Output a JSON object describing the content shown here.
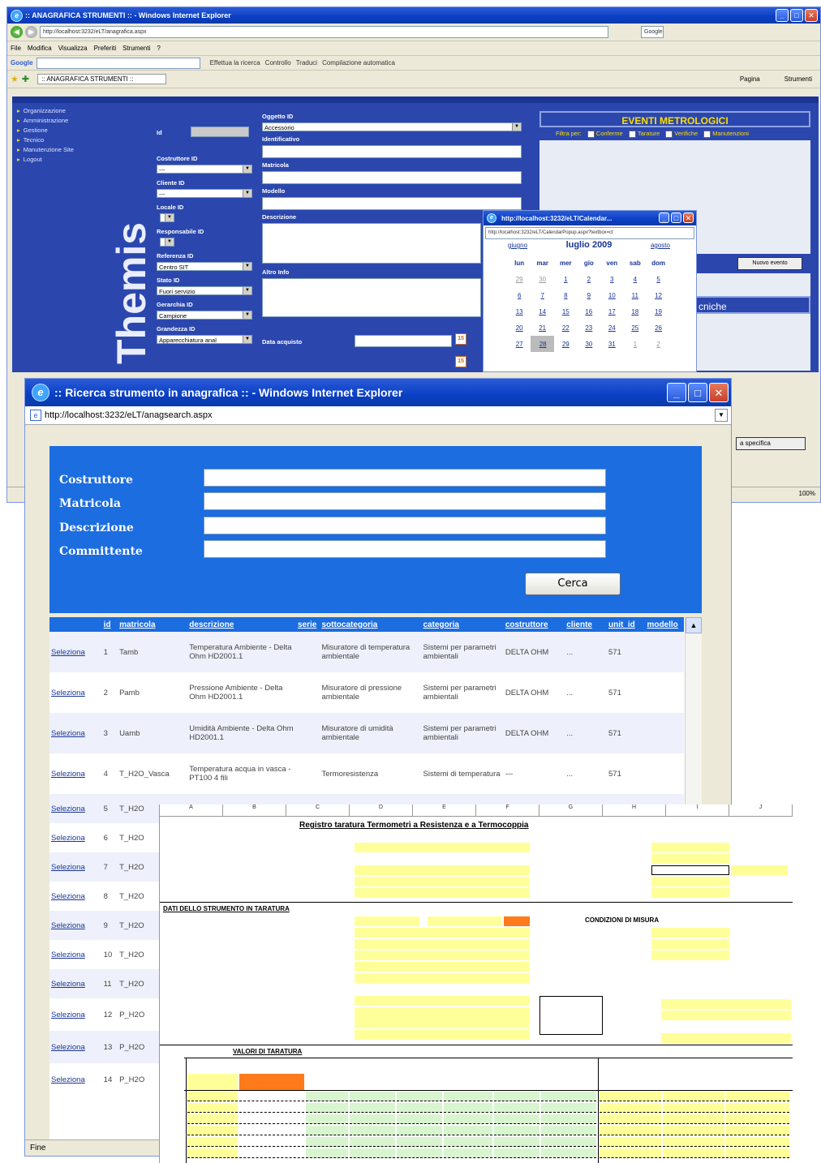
{
  "main_window": {
    "title": ":: ANAGRAFICA STRUMENTI :: - Windows Internet Explorer",
    "url": "http://localhost:3232/eLT/anagrafica.aspx",
    "search_placeholder": "Google",
    "menu": [
      "File",
      "Modifica",
      "Visualizza",
      "Preferiti",
      "Strumenti",
      "?"
    ],
    "google_label": "Google",
    "google_toolbar": [
      "Effettua la ricerca",
      "Controllo",
      "Traduci",
      "Compilazione automatica"
    ],
    "tab_label": ":: ANAGRAFICA STRUMENTI ::",
    "toolbar_right": [
      "Pagina",
      "Strumenti"
    ],
    "left_nav": [
      "Organizzazione",
      "Amministrazione",
      "Gestione",
      "Tecnico",
      "Manutenzione Site",
      "Logout"
    ],
    "brand": "Themis",
    "form": {
      "id_label": "Id",
      "costruttore_label": "Costruttore ID",
      "costruttore_value": "---",
      "cliente_label": "Cliente ID",
      "cliente_value": "---",
      "locale_label": "Locale ID",
      "responsabile_label": "Responsabile ID",
      "referenza_label": "Referenza ID",
      "referenza_value": "Centro SIT",
      "stato_label": "Stato ID",
      "stato_value": "Fuori servizio",
      "gerarchia_label": "Gerarchia ID",
      "gerarchia_value": "Campione",
      "grandezza_label": "Grandezza ID",
      "grandezza_value": "Apparecchiatura anal",
      "oggetto_label": "Oggetto ID",
      "oggetto_value": "Accessorio",
      "identificativo_label": "Identificativo",
      "matricola_label": "Matricola",
      "modello_label": "Modello",
      "descrizione_label": "Descrizione",
      "altro_label": "Altro Info",
      "data_acquisto_label": "Data acquisto",
      "cal_icon_text": "15"
    },
    "eventi": {
      "title": "EVENTI METROLOGICI",
      "filtra": "Filtra per:",
      "filters": [
        "Conferme",
        "Tarature",
        "Verifiche",
        "Manutenzioni"
      ],
      "nuovo_evento": "Nuovo evento",
      "tecniche": "cniche",
      "specifica": "a specifica"
    },
    "zoom": "100%"
  },
  "calendar_popup": {
    "title": "http://localhost:3232/eLT/Calendar...",
    "url": "http://localhost:3232/eLT/CalendarPopup.aspx?textbox=ct",
    "prev": "giugno",
    "month": "luglio 2009",
    "next": "agosto",
    "weekdays": [
      "lun",
      "mar",
      "mer",
      "gio",
      "ven",
      "sab",
      "dom"
    ],
    "weeks": [
      [
        "29",
        "30",
        "1",
        "2",
        "3",
        "4",
        "5"
      ],
      [
        "6",
        "7",
        "8",
        "9",
        "10",
        "11",
        "12"
      ],
      [
        "13",
        "14",
        "15",
        "16",
        "17",
        "18",
        "19"
      ],
      [
        "20",
        "21",
        "22",
        "23",
        "24",
        "25",
        "26"
      ],
      [
        "27",
        "28",
        "29",
        "30",
        "31",
        "1",
        "2"
      ]
    ],
    "selected": "28"
  },
  "search_window": {
    "title": ":: Ricerca strumento in anagrafica :: - Windows Internet Explorer",
    "url": "http://localhost:3232/eLT/anagsearch.aspx",
    "fields": [
      "Costruttore",
      "Matricola",
      "Descrizione",
      "Committente"
    ],
    "cerca": "Cerca",
    "columns": [
      "id",
      "matricola",
      "descrizione",
      "serie",
      "sottocategoria",
      "categoria",
      "costruttore",
      "cliente",
      "unit_id",
      "modello"
    ],
    "select_label": "Seleziona",
    "rows": [
      {
        "id": "1",
        "matricola": "Tamb",
        "descrizione": "Temperatura Ambiente - Delta Ohm HD2001.1",
        "sottocategoria": "Misuratore di temperatura ambientale",
        "categoria": "Sistemi per parametri ambientali",
        "costruttore": "DELTA OHM",
        "cliente": "...",
        "unit": "571"
      },
      {
        "id": "2",
        "matricola": "Pamb",
        "descrizione": "Pressione Ambiente - Delta Ohm HD2001.1",
        "sottocategoria": "Misuratore di pressione ambientale",
        "categoria": "Sistemi per parametri ambientali",
        "costruttore": "DELTA OHM",
        "cliente": "...",
        "unit": "571"
      },
      {
        "id": "3",
        "matricola": "Uamb",
        "descrizione": "Umidità Ambiente - Delta Ohm HD2001.1",
        "sottocategoria": "Misuratore di umidità ambientale",
        "categoria": "Sistemi per parametri ambientali",
        "costruttore": "DELTA OHM",
        "cliente": "...",
        "unit": "571"
      },
      {
        "id": "4",
        "matricola": "T_H2O_Vasca",
        "descrizione": "Temperatura acqua in vasca - PT100 4 fili",
        "sottocategoria": "Termoresistenza",
        "categoria": "Sistemi di temperatura",
        "costruttore": "---",
        "cliente": "...",
        "unit": "571"
      },
      {
        "id": "5",
        "matricola": "T_H2O"
      },
      {
        "id": "6",
        "matricola": "T_H2O"
      },
      {
        "id": "7",
        "matricola": "T_H2O"
      },
      {
        "id": "8",
        "matricola": "T_H2O"
      },
      {
        "id": "9",
        "matricola": "T_H2O"
      },
      {
        "id": "10",
        "matricola": "T_H2O"
      },
      {
        "id": "11",
        "matricola": "T_H2O"
      },
      {
        "id": "12",
        "matricola": "P_H2O"
      },
      {
        "id": "13",
        "matricola": "P_H2O"
      },
      {
        "id": "14",
        "matricola": "P_H2O"
      }
    ],
    "status": "Fine"
  },
  "excel": {
    "title": "Registro taratura Termometri a Resistenza e a Termocoppia",
    "section1": "DATI DELLO STRUMENTO IN TARATURA",
    "section2": "CONDIZIONI DI MISURA",
    "section3": "VALORI DI TARATURA"
  }
}
